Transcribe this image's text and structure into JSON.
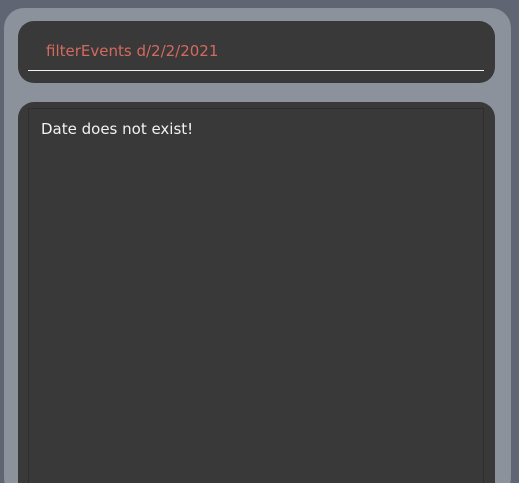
{
  "command_box": {
    "value": "filterEvents d/2/2/2021",
    "text_color": "#d46a5f"
  },
  "result_display": {
    "message": "Date does not exist!"
  },
  "colors": {
    "background": "#5f6572",
    "panel": "#8c929c",
    "box": "#393939",
    "text": "#f2f2f2"
  }
}
